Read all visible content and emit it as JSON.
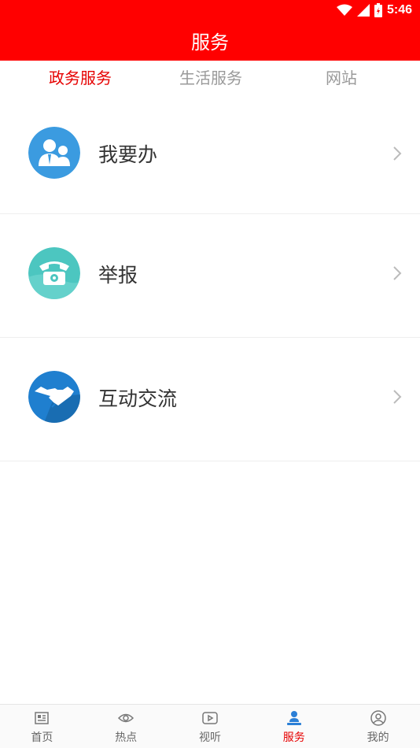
{
  "status_bar": {
    "time": "5:46"
  },
  "header": {
    "title": "服务"
  },
  "tabs": [
    {
      "label": "政务服务",
      "active": true
    },
    {
      "label": "生活服务",
      "active": false
    },
    {
      "label": "网站",
      "active": false
    }
  ],
  "services": [
    {
      "label": "我要办",
      "icon": "users-icon",
      "color": "#3b9be0"
    },
    {
      "label": "举报",
      "icon": "telephone-icon",
      "color": "#4cc6c0"
    },
    {
      "label": "互动交流",
      "icon": "handshake-icon",
      "color": "#1f7fcf"
    }
  ],
  "bottom_nav": [
    {
      "label": "首页",
      "icon": "news-icon",
      "active": false
    },
    {
      "label": "热点",
      "icon": "eye-icon",
      "active": false
    },
    {
      "label": "视听",
      "icon": "play-icon",
      "active": false
    },
    {
      "label": "服务",
      "icon": "service-icon",
      "active": true
    },
    {
      "label": "我的",
      "icon": "profile-icon",
      "active": false
    }
  ],
  "colors": {
    "brand": "#ff0000",
    "active_text": "#e60000",
    "inactive_text": "#999999"
  }
}
